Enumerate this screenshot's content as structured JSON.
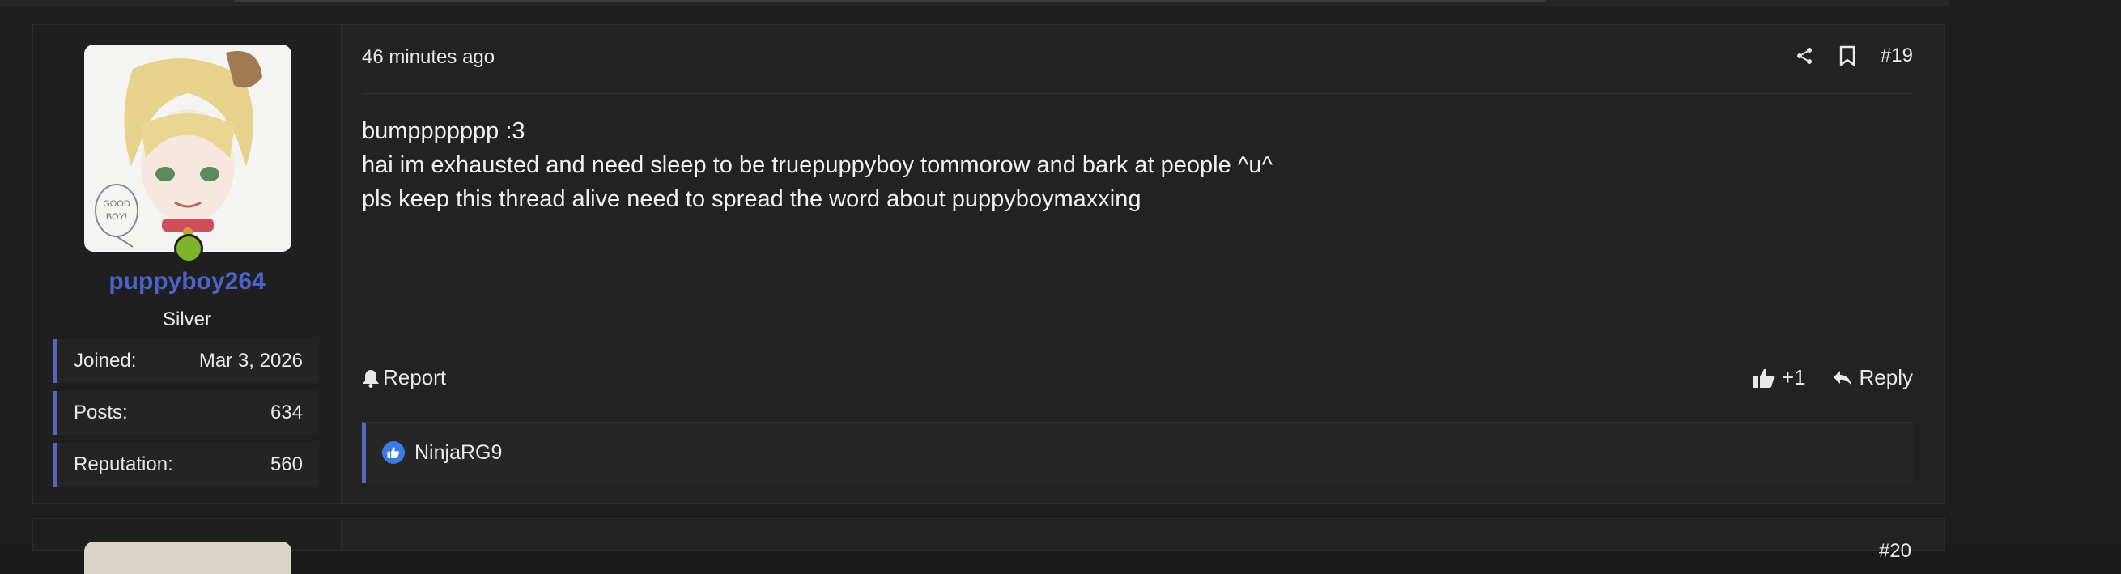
{
  "post": {
    "timestamp": "46 minutes ago",
    "post_number": "#19",
    "body_lines": [
      "bumppppppp :3",
      "hai im exhausted and need sleep to be truepuppyboy tommorow and bark at people ^u^",
      "pls keep this thread alive need to spread the word about puppyboymaxxing"
    ],
    "report_label": "Report",
    "like_count": "+1",
    "reply_label": "Reply",
    "liked_by": "NinjaRG9"
  },
  "user": {
    "name": "puppyboy264",
    "title": "Silver",
    "avatar_caption": "GOOD BOY!",
    "online": true,
    "stats": [
      {
        "label": "Joined:",
        "value": "Mar 3, 2026"
      },
      {
        "label": "Posts:",
        "value": "634"
      },
      {
        "label": "Reputation:",
        "value": "560"
      }
    ]
  },
  "next_post": {
    "post_number": "#20"
  },
  "icons": {
    "share": "share-icon",
    "bookmark": "bookmark-icon",
    "report": "bell-icon",
    "like": "thumbs-up-icon",
    "reply": "reply-arrow-icon"
  },
  "colors": {
    "username": "#4b62c9",
    "accent_border": "#5566c0",
    "online": "#7fb32c",
    "like_badge": "#3c7be0"
  }
}
